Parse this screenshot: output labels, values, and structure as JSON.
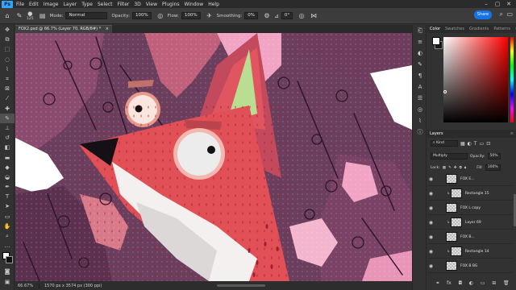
{
  "menu": {
    "logo": "Ps",
    "items": [
      "File",
      "Edit",
      "Image",
      "Layer",
      "Type",
      "Select",
      "Filter",
      "3D",
      "View",
      "Plugins",
      "Window",
      "Help"
    ]
  },
  "options": {
    "brush_size": "125",
    "mode_label": "Mode:",
    "mode_value": "Normal",
    "opacity_label": "Opacity:",
    "opacity_value": "100%",
    "flow_label": "Flow:",
    "flow_value": "100%",
    "smoothing_label": "Smoothing:",
    "smoothing_value": "0%",
    "angle_value": "0°",
    "share_label": "Share"
  },
  "document": {
    "tab_title": "FOX2.psd @ 66.7% (Layer 70, RGB/8#) *",
    "close": "×"
  },
  "status": {
    "zoom": "66.67%",
    "info": "1570 px x 3574 px (300 ppi)"
  },
  "color_panel": {
    "tabs": [
      "Color",
      "Swatches",
      "Gradients",
      "Patterns"
    ],
    "fg_color": "#ffffff",
    "bg_color": "#1a1a1a"
  },
  "layers_panel": {
    "title": "Layers",
    "filter_label": "Kind",
    "blend_mode": "Multiply",
    "opacity_label": "Opacity:",
    "opacity_value": "50%",
    "lock_label": "Lock:",
    "fill_label": "Fill:",
    "fill_value": "100%",
    "layers": [
      {
        "name": "FOX E...",
        "clipped": false
      },
      {
        "name": "Rectangle 15",
        "clipped": true
      },
      {
        "name": "FOX L copy",
        "clipped": false
      },
      {
        "name": "Layer 69",
        "clipped": true
      },
      {
        "name": "FOX B...",
        "clipped": false
      },
      {
        "name": "Rectangle 14",
        "clipped": true
      },
      {
        "name": "FOX B BG",
        "clipped": false
      }
    ]
  }
}
